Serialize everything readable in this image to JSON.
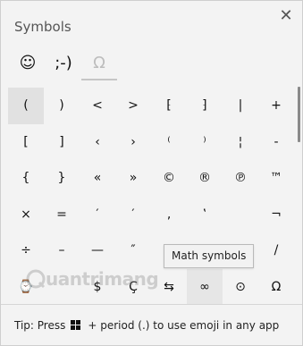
{
  "window": {
    "title": "Symbols",
    "close_glyph": "✕"
  },
  "tabs": [
    {
      "label": "☺"
    },
    {
      "label": ";-)"
    },
    {
      "label": "Ω"
    }
  ],
  "symbols": [
    "(",
    ")",
    "<",
    ">",
    "⁅",
    "⁆",
    "|",
    "+",
    "[",
    "]",
    "‹",
    "›",
    "⁽",
    "⁾",
    "¦",
    "-",
    "{",
    "}",
    "«",
    "»",
    "©",
    "®",
    "℗",
    "™",
    "×",
    "=",
    "′",
    "′",
    "‚",
    "‛",
    "",
    "¬",
    "÷",
    "–",
    "—",
    "″",
    "",
    "",
    "",
    "/",
    "⌚",
    "",
    "$",
    "Ç",
    "⇆",
    "∞",
    "⊙",
    "Ω"
  ],
  "tooltip": "Math symbols",
  "watermark": "uantrimang",
  "footer": {
    "tip_before": "Tip: Press",
    "tip_after": "+ period (.) to use emoji in any app"
  }
}
